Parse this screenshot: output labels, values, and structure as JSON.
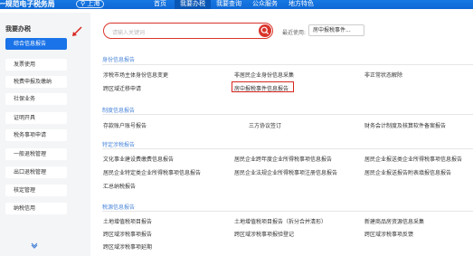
{
  "header": {
    "brand": "一规范电子税务局",
    "region": "上海",
    "nav": [
      "首页",
      "我要办税",
      "我要查询",
      "公众服务",
      "地方特色"
    ]
  },
  "sidebar": {
    "title": "我要办税",
    "items": [
      "综合信息报告",
      "发票使用",
      "税费申报及缴纳",
      "社保业务",
      "证明开具",
      "税务事项申请",
      "一般退税管理",
      "出口退税管理",
      "核定管理",
      "纳税信用"
    ]
  },
  "search": {
    "placeholder": "请输入关键词",
    "recent_label": "最近使用:",
    "recent_item": "房中报税事件..."
  },
  "sections": {
    "s1": {
      "title": "身份信息报告",
      "r1": [
        "涉税市场主体身份信息变更",
        "非居民企业身份信息采集",
        "非正常状态解除"
      ],
      "r2": [
        "跨区域迁移申请",
        "房中报税事件信息报告"
      ]
    },
    "s2": {
      "title": "制度信息报告",
      "r1": [
        "存款账户账号报告",
        "三方协议签订",
        "财务会计制度及核算软件备案报告"
      ]
    },
    "s3": {
      "title": "特定涉税报告",
      "r1": [
        "文化事业建设费缴费信息报告",
        "居民企业跨年度企业所得税事项信息报告",
        "居民企业报送类企业所得税事项信息报告"
      ],
      "r2": [
        "居民企业特定类企业所得税事项信息报告",
        "居民企业法规企业所得税事项注册信息报告",
        "居民企业报送报告附表填报信息报告"
      ],
      "r3": [
        "汇总纳税报告"
      ]
    },
    "s4": {
      "title": "税源信息报告",
      "r1": [
        "土地增值税项目报告",
        "土地增值税项目报告（拆分合并清形）",
        "新建商品房资源信息采集"
      ],
      "r2": [
        "跨区域涉税事项报告",
        "跨区域涉税事项报验登记",
        "跨区域涉税事项反馈"
      ],
      "r3": [
        "跨区域涉税事项延期"
      ]
    }
  }
}
